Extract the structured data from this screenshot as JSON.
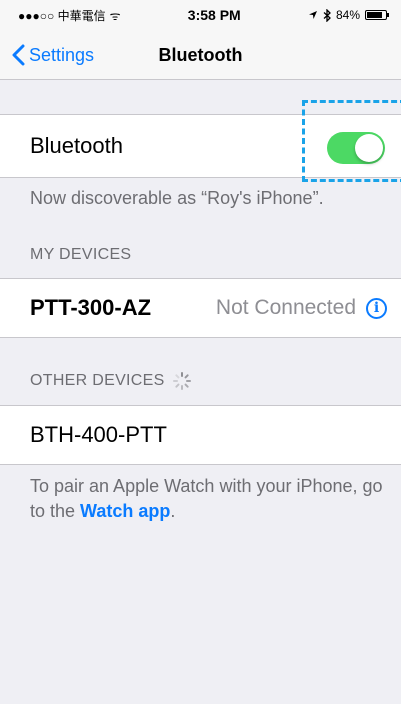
{
  "status_bar": {
    "carrier": "●●●○○ 中華電信",
    "wifi": "ᯤ",
    "time": "3:58 PM",
    "location_icon": "location-arrow",
    "bluetooth_icon": "bluetooth",
    "battery_percent": "84%",
    "battery_level": 0.84
  },
  "nav": {
    "back_label": "Settings",
    "title": "Bluetooth"
  },
  "bluetooth_row": {
    "label": "Bluetooth",
    "enabled": true,
    "toggle_color": "#4cd964"
  },
  "discoverable_text": "Now discoverable as “Roy's iPhone”.",
  "my_devices": {
    "header": "MY DEVICES",
    "items": [
      {
        "name": "PTT-300-AZ",
        "status": "Not Connected"
      }
    ]
  },
  "other_devices": {
    "header": "OTHER DEVICES",
    "items": [
      {
        "name": "BTH-400-PTT"
      }
    ]
  },
  "watch_note": {
    "prefix": "To pair an Apple Watch with your iPhone, go to the ",
    "link": "Watch app",
    "suffix": "."
  },
  "colors": {
    "accent": "#0a7bff",
    "highlight": "#1aa3e8"
  }
}
